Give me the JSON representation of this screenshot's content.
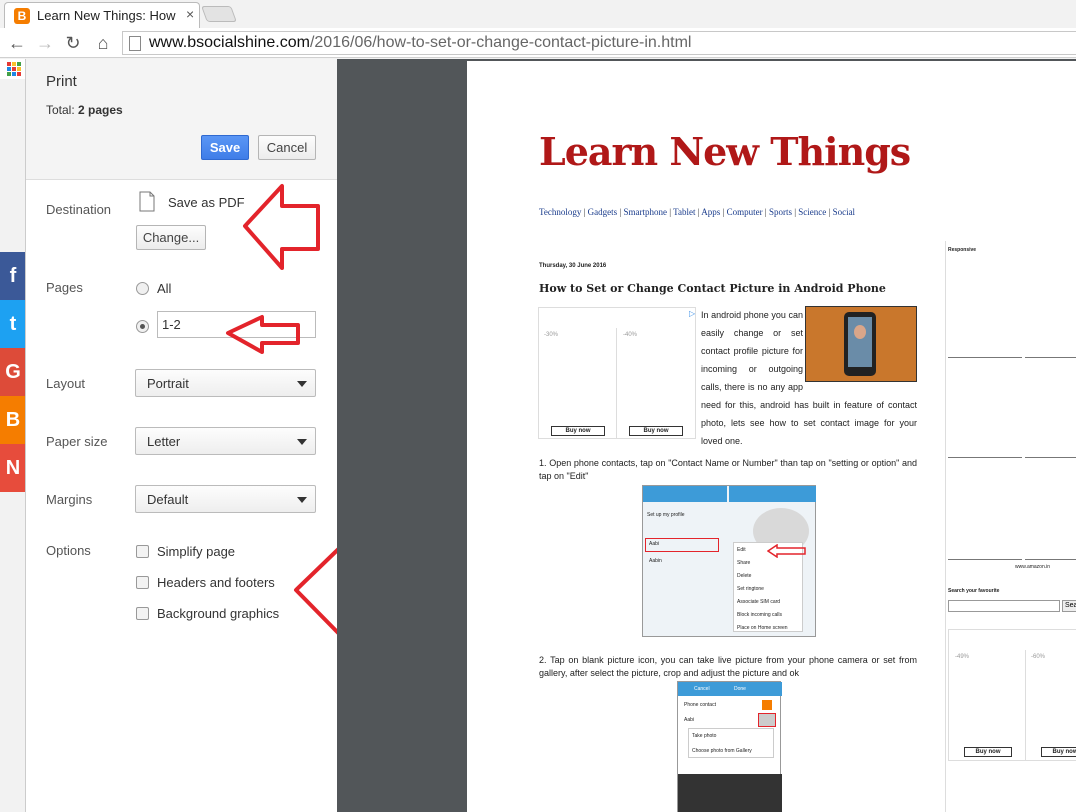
{
  "browser": {
    "tab_title": "Learn New Things: How to",
    "tab_close": "×",
    "url_domain": "www.bsocialshine.com",
    "url_path": "/2016/06/how-to-set-or-change-contact-picture-in.html"
  },
  "share_bar": [
    "f",
    "t",
    "G",
    "B",
    "N"
  ],
  "print": {
    "title": "Print",
    "total_label": "Total:",
    "total_value": "2 pages",
    "save_label": "Save",
    "cancel_label": "Cancel",
    "destination_label": "Destination",
    "destination_value": "Save as PDF",
    "change_label": "Change...",
    "pages_label": "Pages",
    "pages_all": "All",
    "pages_range": "1-2",
    "layout_label": "Layout",
    "layout_value": "Portrait",
    "paper_label": "Paper size",
    "paper_value": "Letter",
    "margins_label": "Margins",
    "margins_value": "Default",
    "options_label": "Options",
    "opt_simplify": "Simplify page",
    "opt_headers": "Headers and footers",
    "opt_background": "Background graphics"
  },
  "preview": {
    "blog_title": "Learn New Things",
    "categories": [
      "Technology",
      "Gadgets",
      "Smartphone",
      "Tablet",
      "Apps",
      "Computer",
      "Sports",
      "Science",
      "Social"
    ],
    "date": "Thursday, 30 June 2016",
    "post_title": "How to Set or Change Contact Picture in Android Phone",
    "intro": "In android phone you can easily change or set contact profile picture for incoming or outgoing calls, there is no any app need for this, android has built in feature of contact photo, lets see how to set contact image for your loved one.",
    "ad_pct_1": "-30%",
    "ad_pct_2": "-40%",
    "ad_buy": "Buy now",
    "step1": "1.      Open phone contacts, tap on \"Contact Name or Number\" than tap on \"setting or option\" and tap on \"Edit\"",
    "step2": "2.      Tap on blank picture icon, you can take live picture from your phone camera or set from gallery, after select the picture, crop and adjust the picture and ok",
    "sidebar_responsive": "Responsive",
    "sidebar_amazon": "www.amazon.in",
    "sidebar_search": "Search your favourite",
    "sidebar_search_btn": "Sea",
    "sidebar_pct_1": "-49%",
    "sidebar_pct_2": "-60%",
    "phone1_menu": [
      "Edit",
      "Share",
      "Delete",
      "Set ringtone",
      "Associate SIM card",
      "Block incoming calls",
      "Place on Home screen"
    ],
    "phone1_contacts": [
      "Set up my profile",
      "Aabi",
      "Aabin"
    ],
    "phone2_header": [
      "Cancel",
      "Done"
    ],
    "phone2_rows": [
      "Phone contact",
      "Aabi",
      "Take photo",
      "Choose photo from Gallery"
    ]
  },
  "colors": {
    "accent_blue": "#4285f4",
    "title_red": "#b01818",
    "arrow_red": "#e3242b",
    "share_colors": [
      "#3b5998",
      "#1da1f2",
      "#dd4b39",
      "#f57d00",
      "#e74c3c"
    ]
  }
}
